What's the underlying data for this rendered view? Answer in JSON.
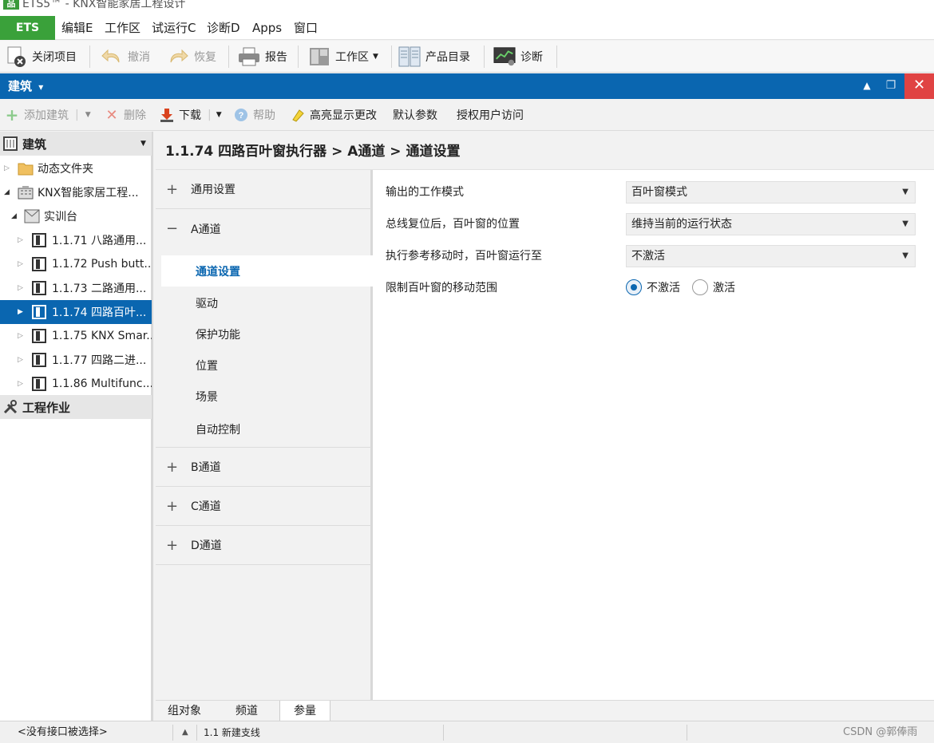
{
  "window": {
    "app_icon": "品",
    "title": "ETS5™ - KNX智能家居工程设计"
  },
  "menubar": {
    "ets": "ETS",
    "items": [
      "编辑E",
      "工作区",
      "试运行C",
      "诊断D",
      "Apps",
      "窗口"
    ]
  },
  "toolbar": {
    "close_project": "关闭项目",
    "undo": "撤消",
    "redo": "恢复",
    "report": "报告",
    "workspace": "工作区",
    "catalog": "产品目录",
    "diagnostics": "诊断"
  },
  "panel_header": {
    "title": "建筑",
    "caret": "▾",
    "close": "✕",
    "up": "▲",
    "restore": "❐"
  },
  "subtoolbar": {
    "add_building": "添加建筑",
    "delete": "删除",
    "download": "下载",
    "help": "帮助",
    "highlight": "高亮显示更改",
    "default_params": "默认参数",
    "authorize": "授权用户访问"
  },
  "tree": {
    "header": "建筑",
    "items": [
      {
        "label": "动态文件夹",
        "icon": "folder-icon"
      },
      {
        "label": "KNX智能家居工程..."
      },
      {
        "label": "实训台"
      },
      {
        "label": "1.1.71 八路通用..."
      },
      {
        "label": "1.1.72 Push butt..."
      },
      {
        "label": "1.1.73 二路通用..."
      },
      {
        "label": "1.1.74 四路百叶..."
      },
      {
        "label": "1.1.75 KNX Smar..."
      },
      {
        "label": "1.1.77 四路二进..."
      },
      {
        "label": "1.1.86 Multifunc..."
      }
    ],
    "footer": "工程作业"
  },
  "breadcrumb": "1.1.74 四路百叶窗执行器 > A通道 > 通道设置",
  "nav": {
    "general": "通用设置",
    "channel_a": "A通道",
    "sub_items": [
      "通道设置",
      "驱动",
      "保护功能",
      "位置",
      "场景",
      "自动控制"
    ],
    "channel_b": "B通道",
    "channel_c": "C通道",
    "channel_d": "D通道",
    "plus": "+",
    "minus": "−"
  },
  "params": {
    "rows": [
      {
        "label": "输出的工作模式",
        "value": "百叶窗模式"
      },
      {
        "label": "总线复位后，百叶窗的位置",
        "value": "维持当前的运行状态"
      },
      {
        "label": "执行参考移动时，百叶窗运行至",
        "value": "不激活"
      }
    ],
    "limit_label": "限制百叶窗的移动范围",
    "radio_off": "不激活",
    "radio_on": "激活",
    "selected": "不激活"
  },
  "bottom_tabs": [
    "组对象",
    "频道",
    "参量"
  ],
  "active_tab": "参量",
  "statusbar": {
    "interface": "<没有接口被选择>",
    "arrow": "▲",
    "line": "1.1 新建支线",
    "watermark": "CSDN @郭俸雨"
  },
  "colors": {
    "accent": "#0a66b0",
    "ets_green": "#3aa13a",
    "close_red": "#e04343"
  }
}
